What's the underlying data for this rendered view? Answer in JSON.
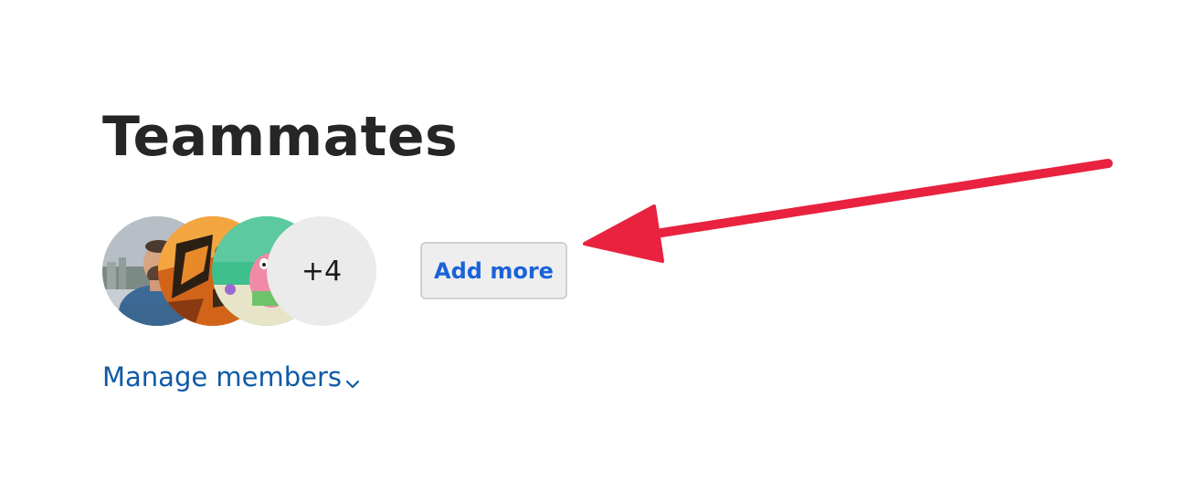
{
  "section": {
    "title": "Teammates"
  },
  "avatars": {
    "items": [
      {
        "name": "teammate-avatar-1",
        "description": "photo avatar"
      },
      {
        "name": "teammate-avatar-2",
        "description": "photo avatar"
      },
      {
        "name": "teammate-avatar-3",
        "description": "photo avatar"
      }
    ],
    "overflow_count": "+4"
  },
  "actions": {
    "add_more_label": "Add more",
    "manage_members_label": "Manage members"
  },
  "icons": {
    "manage_chevron": "chevron-down-icon",
    "annotation": "red-arrow-annotation"
  },
  "colors": {
    "title": "#262626",
    "add_more_text": "#1a63d8",
    "manage_link": "#0f5aa6",
    "overflow_bg": "#ebebeb",
    "annotation_arrow": "#e8223f"
  }
}
